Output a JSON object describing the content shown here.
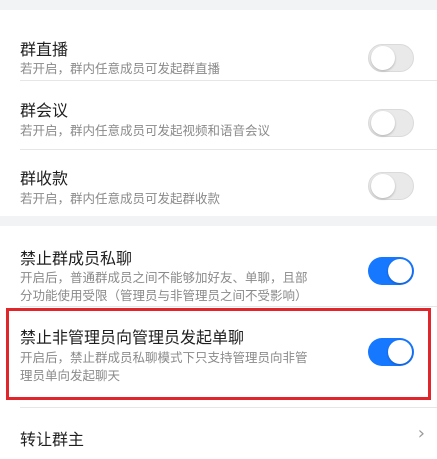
{
  "settings": {
    "live": {
      "title": "群直播",
      "subtitle": "若开启，群内任意成员可发起群直播",
      "enabled": false
    },
    "meeting": {
      "title": "群会议",
      "subtitle": "若开启，群内任意成员可发起视频和语音会议",
      "enabled": false
    },
    "payment": {
      "title": "群收款",
      "subtitle": "若开启，群内任意成员可发起群收款",
      "enabled": false
    },
    "private_chat": {
      "title": "禁止群成员私聊",
      "subtitle_line1": "开启后，普通群成员之间不能够加好友、单聊，且部",
      "subtitle_line2": "分功能使用受限（管理员与非管理员之间不受影响）",
      "enabled": true
    },
    "admin_chat": {
      "title": "禁止非管理员向管理员发起单聊",
      "subtitle_line1": "开启后，禁止群成员私聊模式下只支持管理员向非管",
      "subtitle_line2": "理员单向发起聊天",
      "enabled": true
    },
    "transfer": {
      "title": "转让群主",
      "chevron": "›"
    }
  },
  "colors": {
    "toggle_on": "#1677ff",
    "highlight_border": "#e0262b"
  }
}
